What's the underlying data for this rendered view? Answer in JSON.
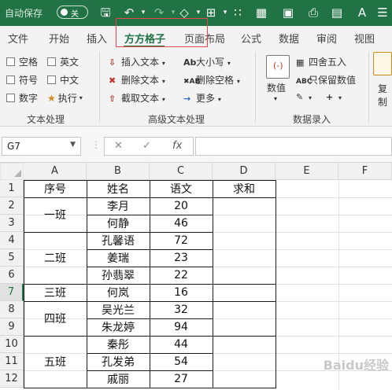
{
  "titlebar": {
    "autosave_label": "自动保存",
    "toggle_label": "关"
  },
  "tabs": [
    "文件",
    "开始",
    "插入",
    "方方格子",
    "页面布局",
    "公式",
    "数据",
    "审阅",
    "视图"
  ],
  "active_tab": "方方格子",
  "ribbon": {
    "text_processing": {
      "checkboxes": [
        "空格",
        "英文",
        "符号",
        "中文",
        "数字"
      ],
      "execute_label": "执行",
      "group_label": "文本处理"
    },
    "advanced_text": {
      "insert_text": "插入文本",
      "delete_text": "删除文本",
      "cut_text": "截取文本",
      "case_label": "大小写",
      "delete_spaces": "删除空格",
      "more_label": "更多",
      "group_label": "高级文本处理"
    },
    "number_entry": {
      "value_label": "数值",
      "round_label": "四舍五入",
      "keep_value": "只保留数值",
      "group_label": "数据录入"
    },
    "copy_label": "复制"
  },
  "formula_bar": {
    "name_box": "G7",
    "fx": "fx",
    "formula": ""
  },
  "columns": [
    "A",
    "B",
    "C",
    "D",
    "E",
    "F"
  ],
  "rows": [
    "1",
    "2",
    "3",
    "4",
    "5",
    "6",
    "7",
    "8",
    "9",
    "10",
    "11",
    "12"
  ],
  "selected_row": "7",
  "table": {
    "headers": {
      "a": "序号",
      "b": "姓名",
      "c": "语文",
      "d": "求和"
    },
    "classes": [
      {
        "name": "一班",
        "students": [
          {
            "name": "李月",
            "score": "20"
          },
          {
            "name": "何静",
            "score": "46"
          }
        ]
      },
      {
        "name": "二班",
        "students": [
          {
            "name": "孔馨语",
            "score": "72"
          },
          {
            "name": "姜瑞",
            "score": "23"
          },
          {
            "name": "孙翡翠",
            "score": "22"
          }
        ]
      },
      {
        "name": "三班",
        "students": [
          {
            "name": "何岚",
            "score": "16"
          }
        ]
      },
      {
        "name": "四班",
        "students": [
          {
            "name": "吴光兰",
            "score": "32"
          },
          {
            "name": "朱龙婷",
            "score": "94"
          }
        ]
      },
      {
        "name": "五班",
        "students": [
          {
            "name": "秦彤",
            "score": "44"
          },
          {
            "name": "孔发弟",
            "score": "54"
          },
          {
            "name": "戚丽",
            "score": "27"
          }
        ]
      }
    ]
  },
  "watermark": "Baidu经验"
}
